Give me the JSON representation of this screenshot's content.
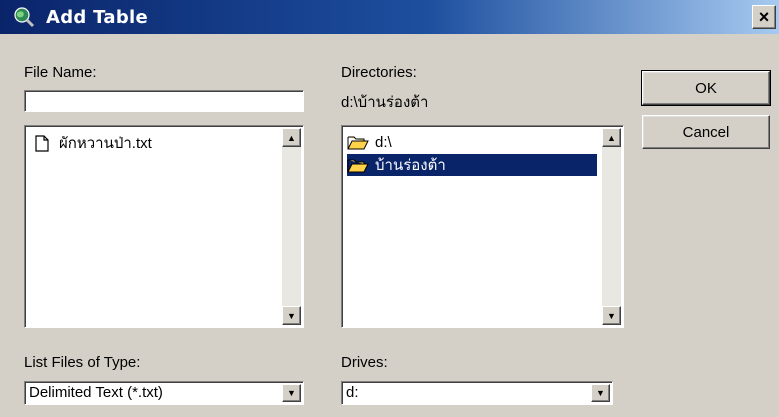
{
  "window": {
    "title": "Add Table",
    "title_icon": "globe-magnifier-icon",
    "close_glyph": "×"
  },
  "file_name": {
    "label": "File Name:",
    "value": "",
    "files": [
      {
        "name": "ผักหวานป่า.txt",
        "icon": "text-file-icon"
      }
    ]
  },
  "directories": {
    "label": "Directories:",
    "current_path": "d:\\บ้านร่องต้า",
    "items": [
      {
        "name": "d:\\",
        "icon": "open-folder-icon",
        "selected": false
      },
      {
        "name": "บ้านร่องต้า",
        "icon": "open-folder-icon",
        "selected": true
      }
    ]
  },
  "buttons": {
    "ok": "OK",
    "cancel": "Cancel"
  },
  "file_type": {
    "label": "List Files of Type:",
    "value": "Delimited Text (*.txt)"
  },
  "drives": {
    "label": "Drives:",
    "value": "d:"
  },
  "glyphs": {
    "up": "▲",
    "down": "▼"
  },
  "colors": {
    "titlebar_start": "#0a246a",
    "titlebar_end": "#a6caf0",
    "selection": "#0a246a",
    "dialog": "#d4d0c8"
  }
}
